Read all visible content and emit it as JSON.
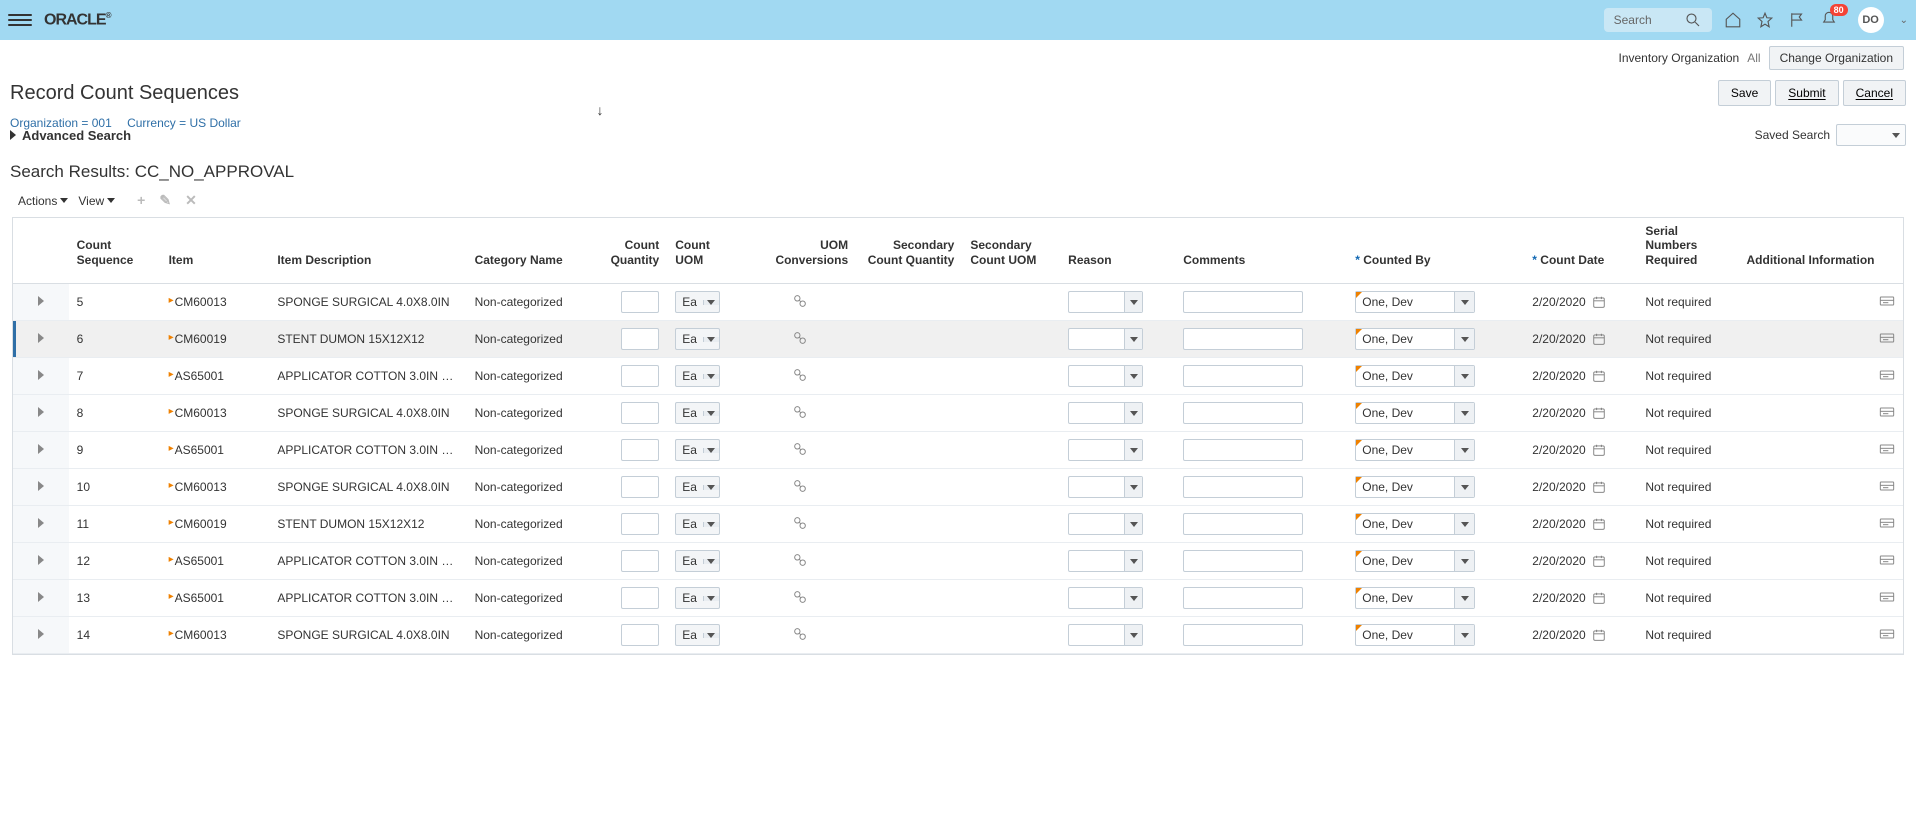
{
  "header": {
    "search_placeholder": "Search",
    "notif_count": "80",
    "user_initials": "DO"
  },
  "sub_header": {
    "inv_org_label": "Inventory Organization",
    "all_label": "All",
    "change_org_label": "Change Organization"
  },
  "title_row": {
    "title": "Record Count Sequences",
    "save": "Save",
    "submit": "Submit",
    "cancel": "Cancel"
  },
  "context": {
    "org": "Organization = 001",
    "currency": "Currency = US Dollar"
  },
  "adv_search": {
    "label": "Advanced Search",
    "saved_label": "Saved Search"
  },
  "results_title": "Search Results: CC_NO_APPROVAL",
  "toolbar": {
    "actions": "Actions",
    "view": "View"
  },
  "columns": {
    "seq": "Count Sequence",
    "item": "Item",
    "desc": "Item Description",
    "cat": "Category Name",
    "qty": "Count Quantity",
    "uom": "Count UOM",
    "conv": "UOM Conversions",
    "secqty": "Secondary Count Quantity",
    "secuom": "Secondary Count UOM",
    "reason": "Reason",
    "comments": "Comments",
    "countedby": "Counted By",
    "countdate": "Count Date",
    "serial": "Serial Numbers Required",
    "addinfo": "Additional Information"
  },
  "rows": [
    {
      "seq": "5",
      "item": "CM60013",
      "desc": "SPONGE SURGICAL 4.0X8.0IN",
      "cat": "Non-categorized",
      "uom": "Ea",
      "counted": "One, Dev",
      "date": "2/20/2020",
      "serial": "Not required"
    },
    {
      "seq": "6",
      "item": "CM60019",
      "desc": "STENT DUMON 15X12X12",
      "cat": "Non-categorized",
      "uom": "Ea",
      "counted": "One, Dev",
      "date": "2/20/2020",
      "serial": "Not required",
      "hl": true
    },
    {
      "seq": "7",
      "item": "AS65001",
      "desc": "APPLICATOR COTTON 3.0IN …",
      "cat": "Non-categorized",
      "uom": "Ea",
      "counted": "One, Dev",
      "date": "2/20/2020",
      "serial": "Not required"
    },
    {
      "seq": "8",
      "item": "CM60013",
      "desc": "SPONGE SURGICAL 4.0X8.0IN",
      "cat": "Non-categorized",
      "uom": "Ea",
      "counted": "One, Dev",
      "date": "2/20/2020",
      "serial": "Not required"
    },
    {
      "seq": "9",
      "item": "AS65001",
      "desc": "APPLICATOR COTTON 3.0IN …",
      "cat": "Non-categorized",
      "uom": "Ea",
      "counted": "One, Dev",
      "date": "2/20/2020",
      "serial": "Not required"
    },
    {
      "seq": "10",
      "item": "CM60013",
      "desc": "SPONGE SURGICAL 4.0X8.0IN",
      "cat": "Non-categorized",
      "uom": "Ea",
      "counted": "One, Dev",
      "date": "2/20/2020",
      "serial": "Not required"
    },
    {
      "seq": "11",
      "item": "CM60019",
      "desc": "STENT DUMON 15X12X12",
      "cat": "Non-categorized",
      "uom": "Ea",
      "counted": "One, Dev",
      "date": "2/20/2020",
      "serial": "Not required"
    },
    {
      "seq": "12",
      "item": "AS65001",
      "desc": "APPLICATOR COTTON 3.0IN …",
      "cat": "Non-categorized",
      "uom": "Ea",
      "counted": "One, Dev",
      "date": "2/20/2020",
      "serial": "Not required"
    },
    {
      "seq": "13",
      "item": "AS65001",
      "desc": "APPLICATOR COTTON 3.0IN …",
      "cat": "Non-categorized",
      "uom": "Ea",
      "counted": "One, Dev",
      "date": "2/20/2020",
      "serial": "Not required"
    },
    {
      "seq": "14",
      "item": "CM60013",
      "desc": "SPONGE SURGICAL 4.0X8.0IN",
      "cat": "Non-categorized",
      "uom": "Ea",
      "counted": "One, Dev",
      "date": "2/20/2020",
      "serial": "Not required"
    }
  ]
}
